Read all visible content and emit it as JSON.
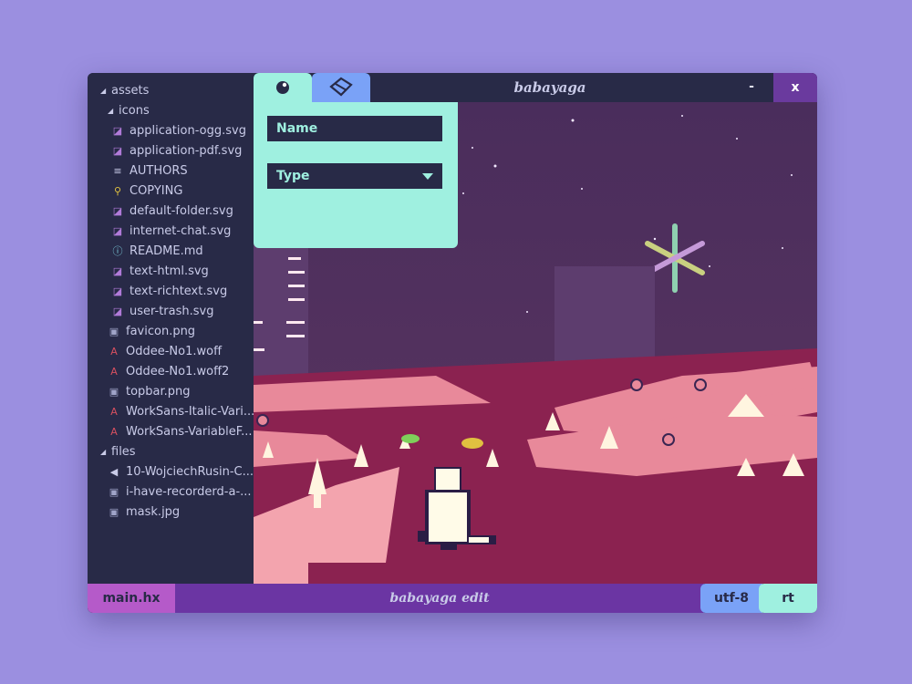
{
  "window": {
    "title": "babayaga",
    "minimize_label": "-",
    "close_label": "x"
  },
  "tabs": [
    {
      "icon": "orb-icon",
      "active": true
    },
    {
      "icon": "cube-icon",
      "active": false
    }
  ],
  "panel": {
    "name_label": "Name",
    "type_label": "Type"
  },
  "tree": [
    {
      "label": "assets",
      "kind": "folder",
      "depth": 0,
      "expanded": true
    },
    {
      "label": "icons",
      "kind": "folder",
      "depth": 1,
      "expanded": true
    },
    {
      "label": "application-ogg.svg",
      "kind": "svg",
      "depth": 2
    },
    {
      "label": "application-pdf.svg",
      "kind": "svg",
      "depth": 2
    },
    {
      "label": "AUTHORS",
      "kind": "text",
      "depth": 2
    },
    {
      "label": "COPYING",
      "kind": "license",
      "depth": 2
    },
    {
      "label": "default-folder.svg",
      "kind": "svg",
      "depth": 2
    },
    {
      "label": "internet-chat.svg",
      "kind": "svg",
      "depth": 2
    },
    {
      "label": "README.md",
      "kind": "info",
      "depth": 2
    },
    {
      "label": "text-html.svg",
      "kind": "svg",
      "depth": 2
    },
    {
      "label": "text-richtext.svg",
      "kind": "svg",
      "depth": 2
    },
    {
      "label": "user-trash.svg",
      "kind": "svg",
      "depth": 2
    },
    {
      "label": "favicon.png",
      "kind": "image",
      "depth": 1
    },
    {
      "label": "Oddee-No1.woff",
      "kind": "font",
      "depth": 1
    },
    {
      "label": "Oddee-No1.woff2",
      "kind": "font",
      "depth": 1
    },
    {
      "label": "topbar.png",
      "kind": "image",
      "depth": 1
    },
    {
      "label": "WorkSans-Italic-Vari...",
      "kind": "font",
      "depth": 1
    },
    {
      "label": "WorkSans-VariableF...",
      "kind": "font",
      "depth": 1
    },
    {
      "label": "files",
      "kind": "folder",
      "depth": 0,
      "expanded": true
    },
    {
      "label": "10-WojciechRusin-C...",
      "kind": "audio",
      "depth": 1
    },
    {
      "label": "i-have-recorderd-a-...",
      "kind": "image",
      "depth": 1
    },
    {
      "label": "mask.jpg",
      "kind": "image",
      "depth": 1
    }
  ],
  "statusbar": {
    "file": "main.hx",
    "center": "babayaga edit",
    "encoding": "utf-8",
    "mode": "rt"
  },
  "colors": {
    "accent_mint": "#9ff0e0",
    "accent_blue": "#7aa2f7",
    "accent_purple": "#6b35a3",
    "accent_magenta": "#b55ac9",
    "bg_dark": "#282a47"
  }
}
